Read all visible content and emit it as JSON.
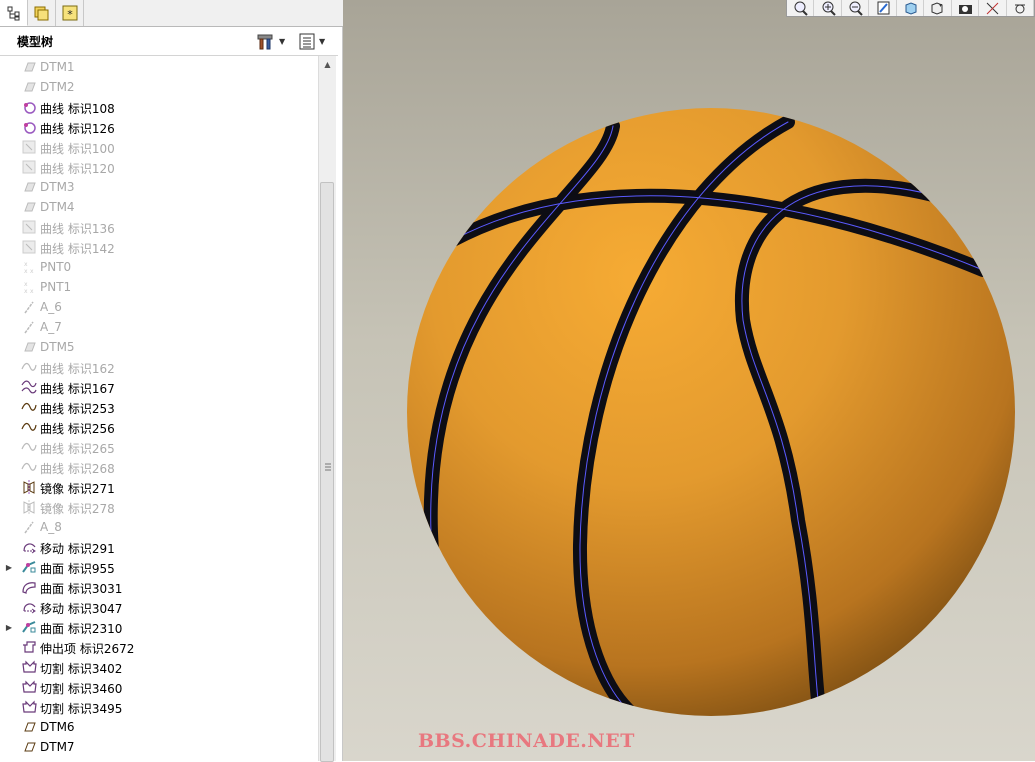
{
  "tree": {
    "title": "模型树",
    "items": [
      {
        "label": "DTM1",
        "dim": true,
        "icon": "datum-plane-icon",
        "expander": false
      },
      {
        "label": "DTM2",
        "dim": true,
        "icon": "datum-plane-icon",
        "expander": false
      },
      {
        "label": "曲线 标识108",
        "dim": false,
        "icon": "curve-point-icon",
        "expander": false
      },
      {
        "label": "曲线 标识126",
        "dim": false,
        "icon": "curve-point-icon",
        "expander": false
      },
      {
        "label": "曲线 标识100",
        "dim": true,
        "icon": "curve-sketch-icon",
        "expander": false
      },
      {
        "label": "曲线 标识120",
        "dim": true,
        "icon": "curve-sketch-icon",
        "expander": false
      },
      {
        "label": "DTM3",
        "dim": true,
        "icon": "datum-plane-icon",
        "expander": false
      },
      {
        "label": "DTM4",
        "dim": true,
        "icon": "datum-plane-icon",
        "expander": false
      },
      {
        "label": "曲线 标识136",
        "dim": true,
        "icon": "curve-sketch-icon",
        "expander": false
      },
      {
        "label": "曲线 标识142",
        "dim": true,
        "icon": "curve-sketch-icon",
        "expander": false
      },
      {
        "label": "PNT0",
        "dim": true,
        "icon": "datum-point-icon",
        "expander": false
      },
      {
        "label": "PNT1",
        "dim": true,
        "icon": "datum-point-icon",
        "expander": false
      },
      {
        "label": "A_6",
        "dim": true,
        "icon": "datum-axis-icon",
        "expander": false
      },
      {
        "label": "A_7",
        "dim": true,
        "icon": "datum-axis-icon",
        "expander": false
      },
      {
        "label": "DTM5",
        "dim": true,
        "icon": "datum-plane-icon",
        "expander": false
      },
      {
        "label": "曲线 标识162",
        "dim": true,
        "icon": "curve-wave-icon",
        "expander": false
      },
      {
        "label": "曲线 标识167",
        "dim": false,
        "icon": "curve-projected-icon",
        "expander": false
      },
      {
        "label": "曲线 标识253",
        "dim": false,
        "icon": "curve-wave-icon",
        "expander": false
      },
      {
        "label": "曲线 标识256",
        "dim": false,
        "icon": "curve-wave-icon",
        "expander": false
      },
      {
        "label": "曲线 标识265",
        "dim": true,
        "icon": "curve-wave-icon",
        "expander": false
      },
      {
        "label": "曲线 标识268",
        "dim": true,
        "icon": "curve-wave-icon",
        "expander": false
      },
      {
        "label": "镜像 标识271",
        "dim": false,
        "icon": "mirror-icon",
        "expander": false
      },
      {
        "label": "镜像 标识278",
        "dim": true,
        "icon": "mirror-icon",
        "expander": false
      },
      {
        "label": "A_8",
        "dim": true,
        "icon": "datum-axis-icon",
        "expander": false
      },
      {
        "label": "移动 标识291",
        "dim": false,
        "icon": "move-icon",
        "expander": false
      },
      {
        "label": "曲面 标识955",
        "dim": false,
        "icon": "surface-merge-icon",
        "expander": true
      },
      {
        "label": "曲面 标识3031",
        "dim": false,
        "icon": "surface-icon",
        "expander": false
      },
      {
        "label": "移动 标识3047",
        "dim": false,
        "icon": "move-icon",
        "expander": false
      },
      {
        "label": "曲面 标识2310",
        "dim": false,
        "icon": "surface-merge-icon",
        "expander": true
      },
      {
        "label": "伸出项 标识2672",
        "dim": false,
        "icon": "protrusion-icon",
        "expander": false
      },
      {
        "label": "切割 标识3402",
        "dim": false,
        "icon": "cut-icon",
        "expander": false
      },
      {
        "label": "切割 标识3460",
        "dim": false,
        "icon": "cut-icon",
        "expander": false
      },
      {
        "label": "切割 标识3495",
        "dim": false,
        "icon": "cut-icon",
        "expander": false
      },
      {
        "label": "DTM6",
        "dim": false,
        "icon": "datum-plane-icon",
        "expander": false
      },
      {
        "label": "DTM7",
        "dim": false,
        "icon": "datum-plane-icon",
        "expander": false
      }
    ]
  },
  "viewport": {
    "toolbar_icons": [
      "zoom-fit-icon",
      "zoom-in-icon",
      "zoom-out-icon",
      "repaint-icon",
      "orient-icon",
      "saved-views-icon",
      "display-style-icon",
      "datum-display-icon",
      "spin-center-icon"
    ],
    "watermark": "BBS.CHINADE.NET"
  },
  "colors": {
    "ball_base": "#e89a2e",
    "seam": "#0d0d14",
    "seam_edge": "#5a5aff",
    "watermark": "#e8787f",
    "dim_text": "#a8a8a8"
  }
}
